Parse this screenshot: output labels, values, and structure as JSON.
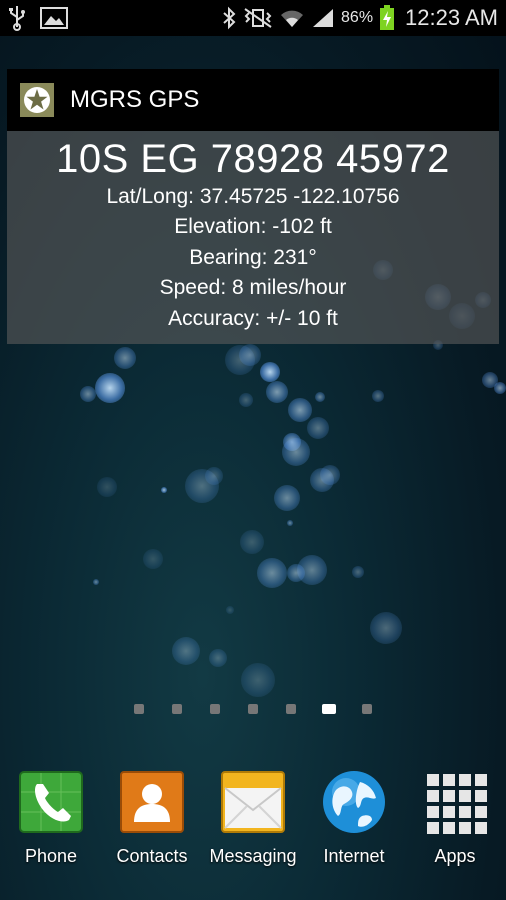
{
  "status_bar": {
    "icons_left": [
      "usb-icon",
      "picture-icon"
    ],
    "icons_right": [
      "bluetooth-icon",
      "vibrate-mute-icon",
      "wifi-icon",
      "signal-icon",
      "battery-charging-icon"
    ],
    "battery": "86%",
    "time": "12:23 AM"
  },
  "widget": {
    "title": "MGRS GPS",
    "mgrs": "10S EG 78928 45972",
    "latlong": "Lat/Long: 37.45725 -122.10756",
    "elevation": "Elevation: -102 ft",
    "bearing": "Bearing: 231°",
    "speed": "Speed: 8 miles/hour",
    "accuracy": "Accuracy: +/- 10 ft"
  },
  "pager": {
    "count": 7,
    "active_index": 5
  },
  "dock": [
    {
      "label": "Phone",
      "icon": "phone-icon"
    },
    {
      "label": "Contacts",
      "icon": "contacts-icon"
    },
    {
      "label": "Messaging",
      "icon": "messaging-icon"
    },
    {
      "label": "Internet",
      "icon": "globe-icon"
    },
    {
      "label": "Apps",
      "icon": "apps-grid-icon"
    }
  ],
  "colors": {
    "widget_logo": "#8a8a5a",
    "battery_charging": "#7ed321",
    "phone_green": "#3ea83a",
    "contacts_orange": "#e07a18",
    "messaging_yellow": "#f2b51f",
    "internet_blue": "#1e8fd8"
  }
}
